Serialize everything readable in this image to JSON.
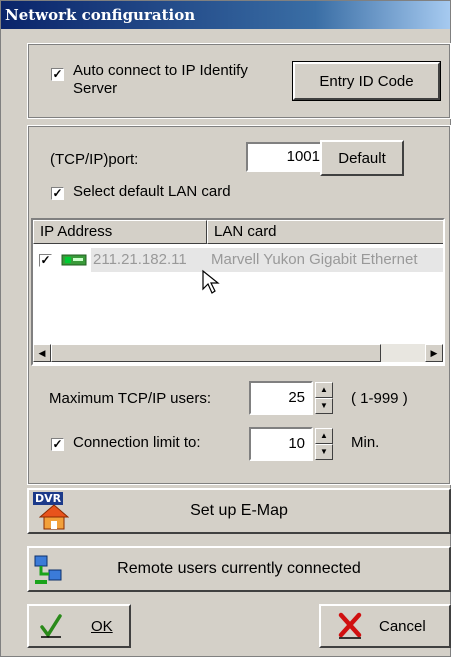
{
  "window": {
    "title": "Network configuration"
  },
  "top_group": {
    "auto_connect_label": "Auto connect to IP Identify Server",
    "auto_connect_checked": true,
    "entry_id_button": "Entry ID Code"
  },
  "port_group": {
    "port_label": "(TCP/IP)port:",
    "port_value": "1001",
    "default_button": "Default",
    "select_lan_label": "Select default LAN card",
    "select_lan_checked": true
  },
  "lan_table": {
    "columns": [
      "IP Address",
      "LAN card"
    ],
    "rows": [
      {
        "checked": true,
        "ip": "211.21.182.11",
        "card": "Marvell Yukon Gigabit Ethernet"
      }
    ]
  },
  "limits": {
    "max_users_label": "Maximum TCP/IP users:",
    "max_users_value": "25",
    "max_users_range": "( 1-999 )",
    "conn_limit_label": "Connection limit to:",
    "conn_limit_checked": true,
    "conn_limit_value": "10",
    "conn_limit_unit": "Min."
  },
  "emap_button": {
    "icon_text": "DVR",
    "label": "Set up E-Map"
  },
  "remote_button": {
    "label": "Remote users currently connected"
  },
  "footer": {
    "ok_label": "OK",
    "cancel_label": "Cancel"
  },
  "icons": {
    "emap": "dvr-house-icon",
    "remote": "network-computers-icon",
    "ok": "checkmark-icon",
    "cancel": "red-x-icon"
  },
  "colors": {
    "titlebar": "#0a246a",
    "panel": "#d4d0c8"
  }
}
